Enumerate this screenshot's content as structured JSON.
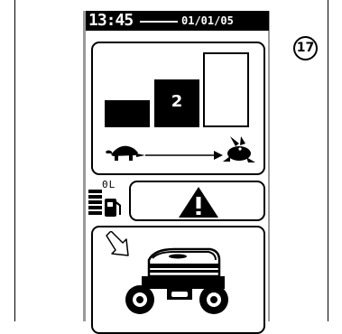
{
  "header": {
    "time": "13:45",
    "date": "01/01/05"
  },
  "callout": {
    "number": "17"
  },
  "speed": {
    "active_gear": "2",
    "gear_count": 3,
    "bars": [
      "low",
      "mid",
      "high"
    ]
  },
  "speed_icons": {
    "slow": "turtle-icon",
    "fast": "rabbit-icon"
  },
  "fuel": {
    "label": "0L",
    "icon": "fuel-gauge-icon"
  },
  "warning": {
    "icon": "warning-triangle-icon"
  },
  "machine": {
    "arrow_icon": "diagonal-arrow-icon",
    "icon": "compactor-machine-icon"
  },
  "colors": {
    "foreground": "#000000",
    "background": "#ffffff",
    "bezel": "#9a9a9a"
  }
}
